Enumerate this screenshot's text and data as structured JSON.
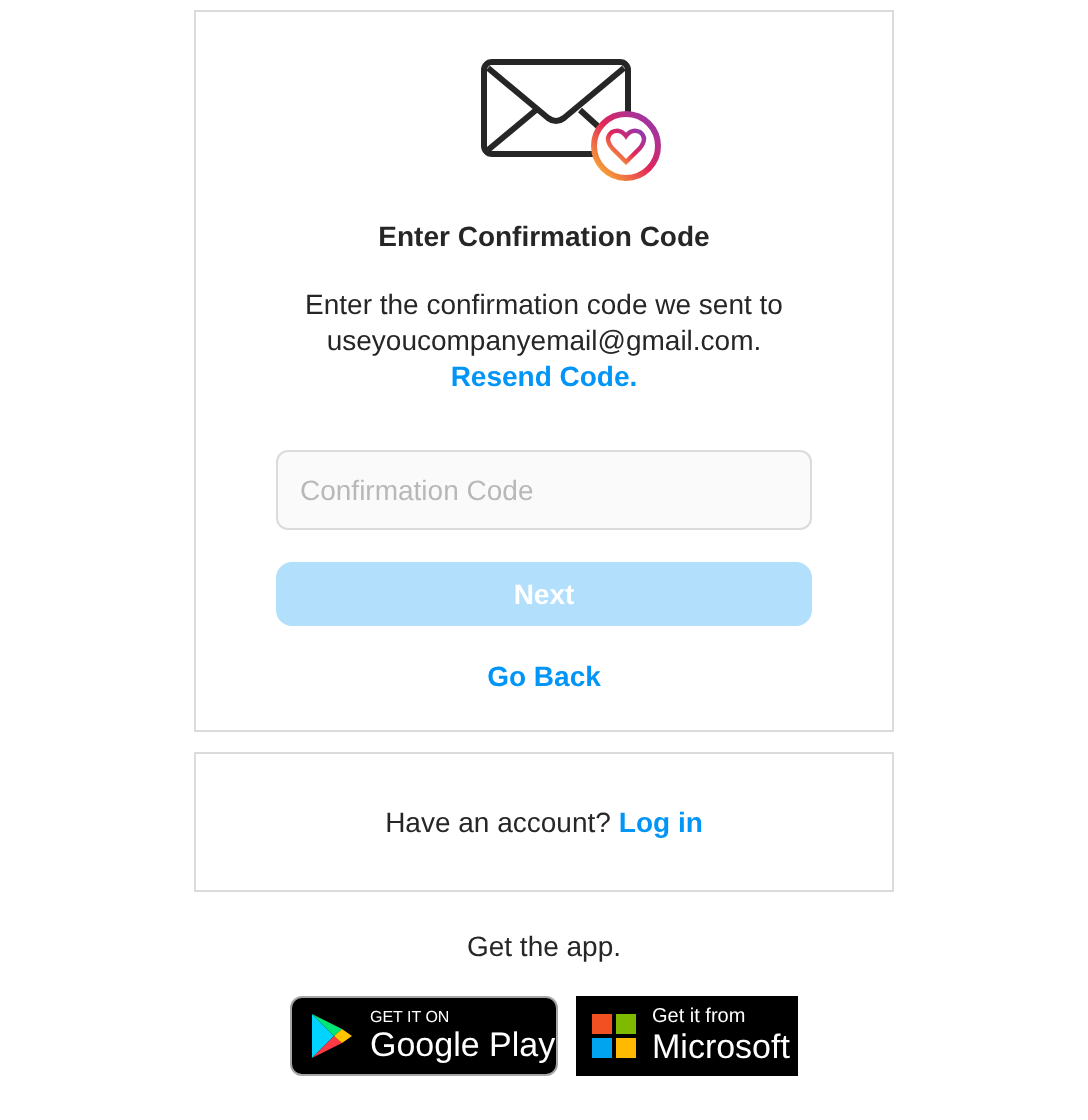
{
  "confirm_card": {
    "title": "Enter Confirmation Code",
    "message": "Enter the confirmation code we sent to useyoucompanyemail@gmail.com.",
    "resend_link": "Resend Code.",
    "code_field": {
      "placeholder": "Confirmation Code"
    },
    "next_button": {
      "label": "Next",
      "disabled": true
    },
    "back_link": "Go Back"
  },
  "login_card": {
    "prompt": "Have an account?",
    "link": "Log in"
  },
  "get_app": "Get the app.",
  "store_badges": [
    {
      "kind": "google",
      "small": "GET IT ON",
      "big": "Google Play"
    },
    {
      "kind": "microsoft",
      "small": "Get it from",
      "big": "Microsoft"
    }
  ]
}
